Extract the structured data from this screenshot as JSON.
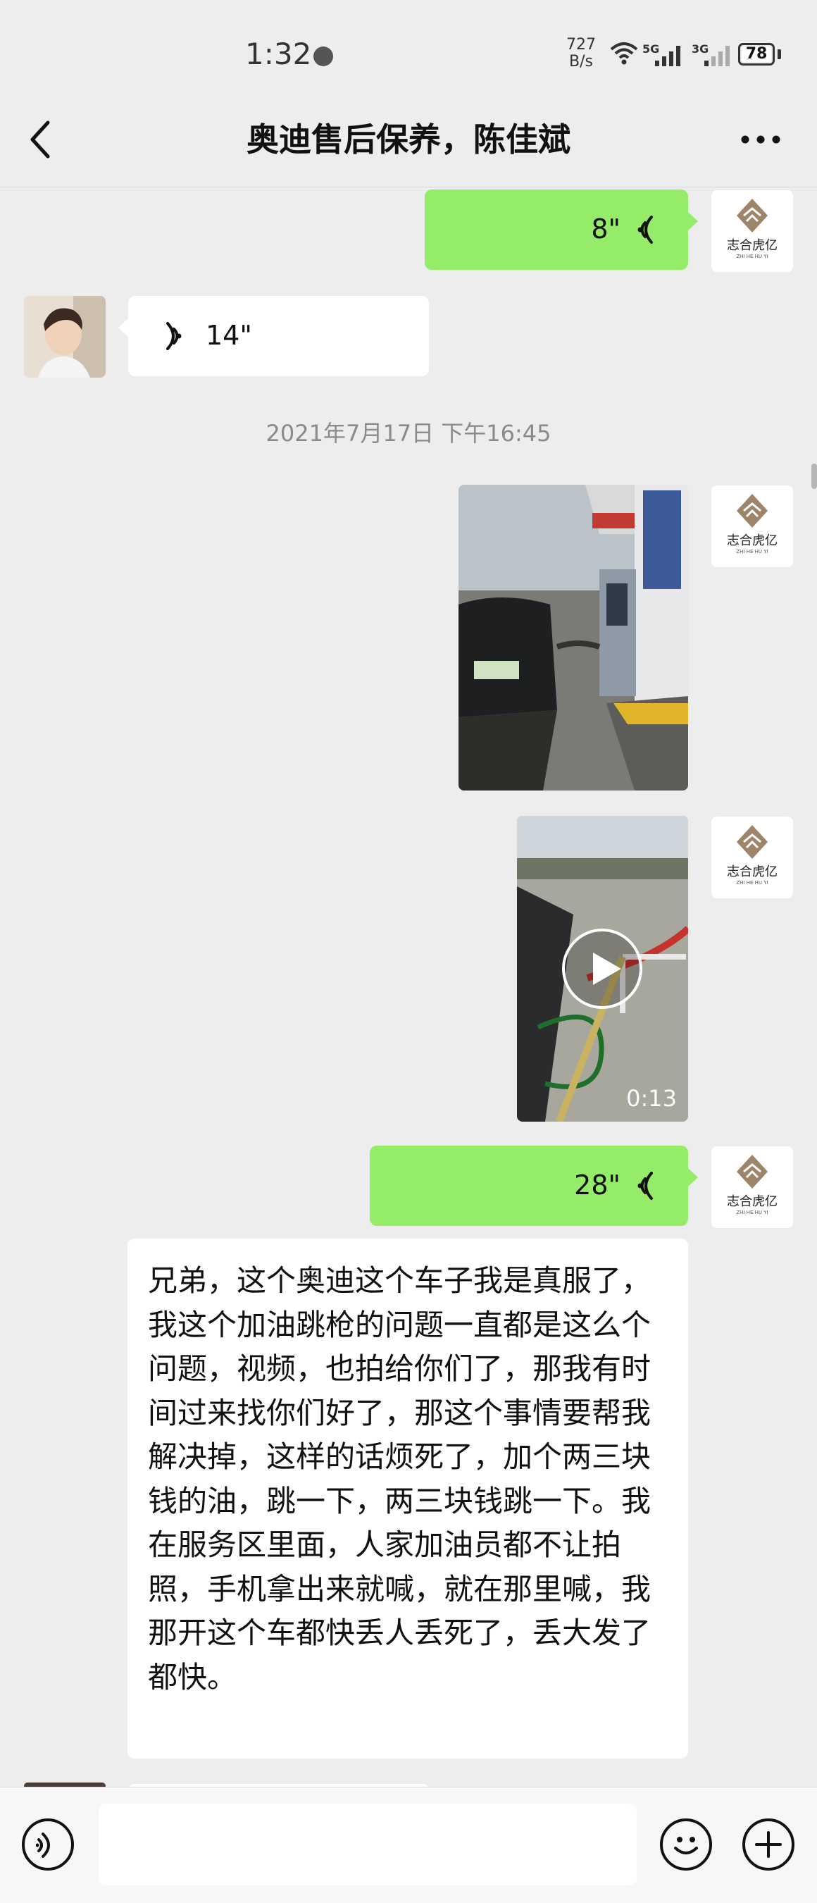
{
  "status_bar": {
    "time": "1:32",
    "net_speed": "727\nB/s",
    "signal_1": "5G",
    "signal_2": "3G",
    "battery": "78"
  },
  "header": {
    "title": "奥迪售后保养，陈佳斌"
  },
  "brand_avatar": {
    "text": "志合虎亿",
    "subtext": "ZHI HE HU YI"
  },
  "messages": {
    "voice_out_1": "8\"",
    "voice_in_1": "14\"",
    "timestamp": "2021年7月17日 下午16:45",
    "video_duration": "0:13",
    "voice_out_2": "28\"",
    "text_in": "兄弟，这个奥迪这个车子我是真服了，我这个加油跳枪的问题一直都是这么个问题，视频，也拍给你们了，那我有时间过来找你们好了，那这个事情要帮我解决掉，这样的话烦死了，加个两三块钱的油，跳一下，两三块钱跳一下。我在服务区里面，人家加油员都不让拍照，手机拿出来就喊，就在那里喊，我那开这个车都快丢人丢死了，丢大发了都快。"
  },
  "colors": {
    "chat_bg": "#ededed",
    "outgoing_bubble": "#95ec69",
    "incoming_bubble": "#ffffff",
    "timestamp_text": "#8a8a8a"
  }
}
